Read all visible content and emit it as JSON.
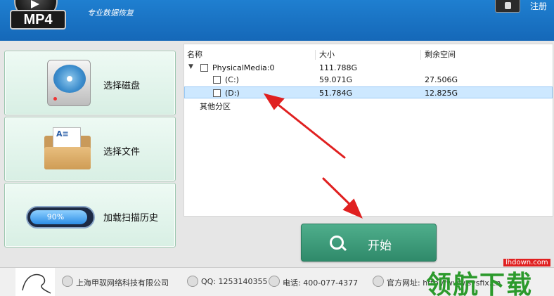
{
  "header": {
    "badge": "MP4",
    "slogan": "专业数据恢复",
    "register_label": "注册"
  },
  "left_panel": {
    "select_disk": "选择磁盘",
    "select_file": "选择文件",
    "load_history": "加载扫描历史",
    "history_progress": "90%"
  },
  "tree": {
    "columns": [
      "名称",
      "大小",
      "剩余空间"
    ],
    "rows": [
      {
        "name": "PhysicalMedia:0",
        "size": "111.788G",
        "free": ""
      },
      {
        "name": "(C:)",
        "size": "59.071G",
        "free": "27.506G"
      },
      {
        "name": "(D:)",
        "size": "51.784G",
        "free": "12.825G"
      }
    ],
    "other_partitions": "其他分区"
  },
  "start_button": {
    "label": "开始"
  },
  "footer": {
    "company": "上海甲驭网络科技有限公司",
    "qq": "QQ: 1253140355",
    "phone": "电话: 400-077-4377",
    "website_label": "官方网址: http://www.sysfix.cn"
  },
  "watermark": {
    "site": "lhdown.com",
    "text": "领航下载"
  },
  "colors": {
    "header_blue": "#1a74c6",
    "accent_green": "#3a9a78",
    "arrow_red": "#e02020"
  }
}
